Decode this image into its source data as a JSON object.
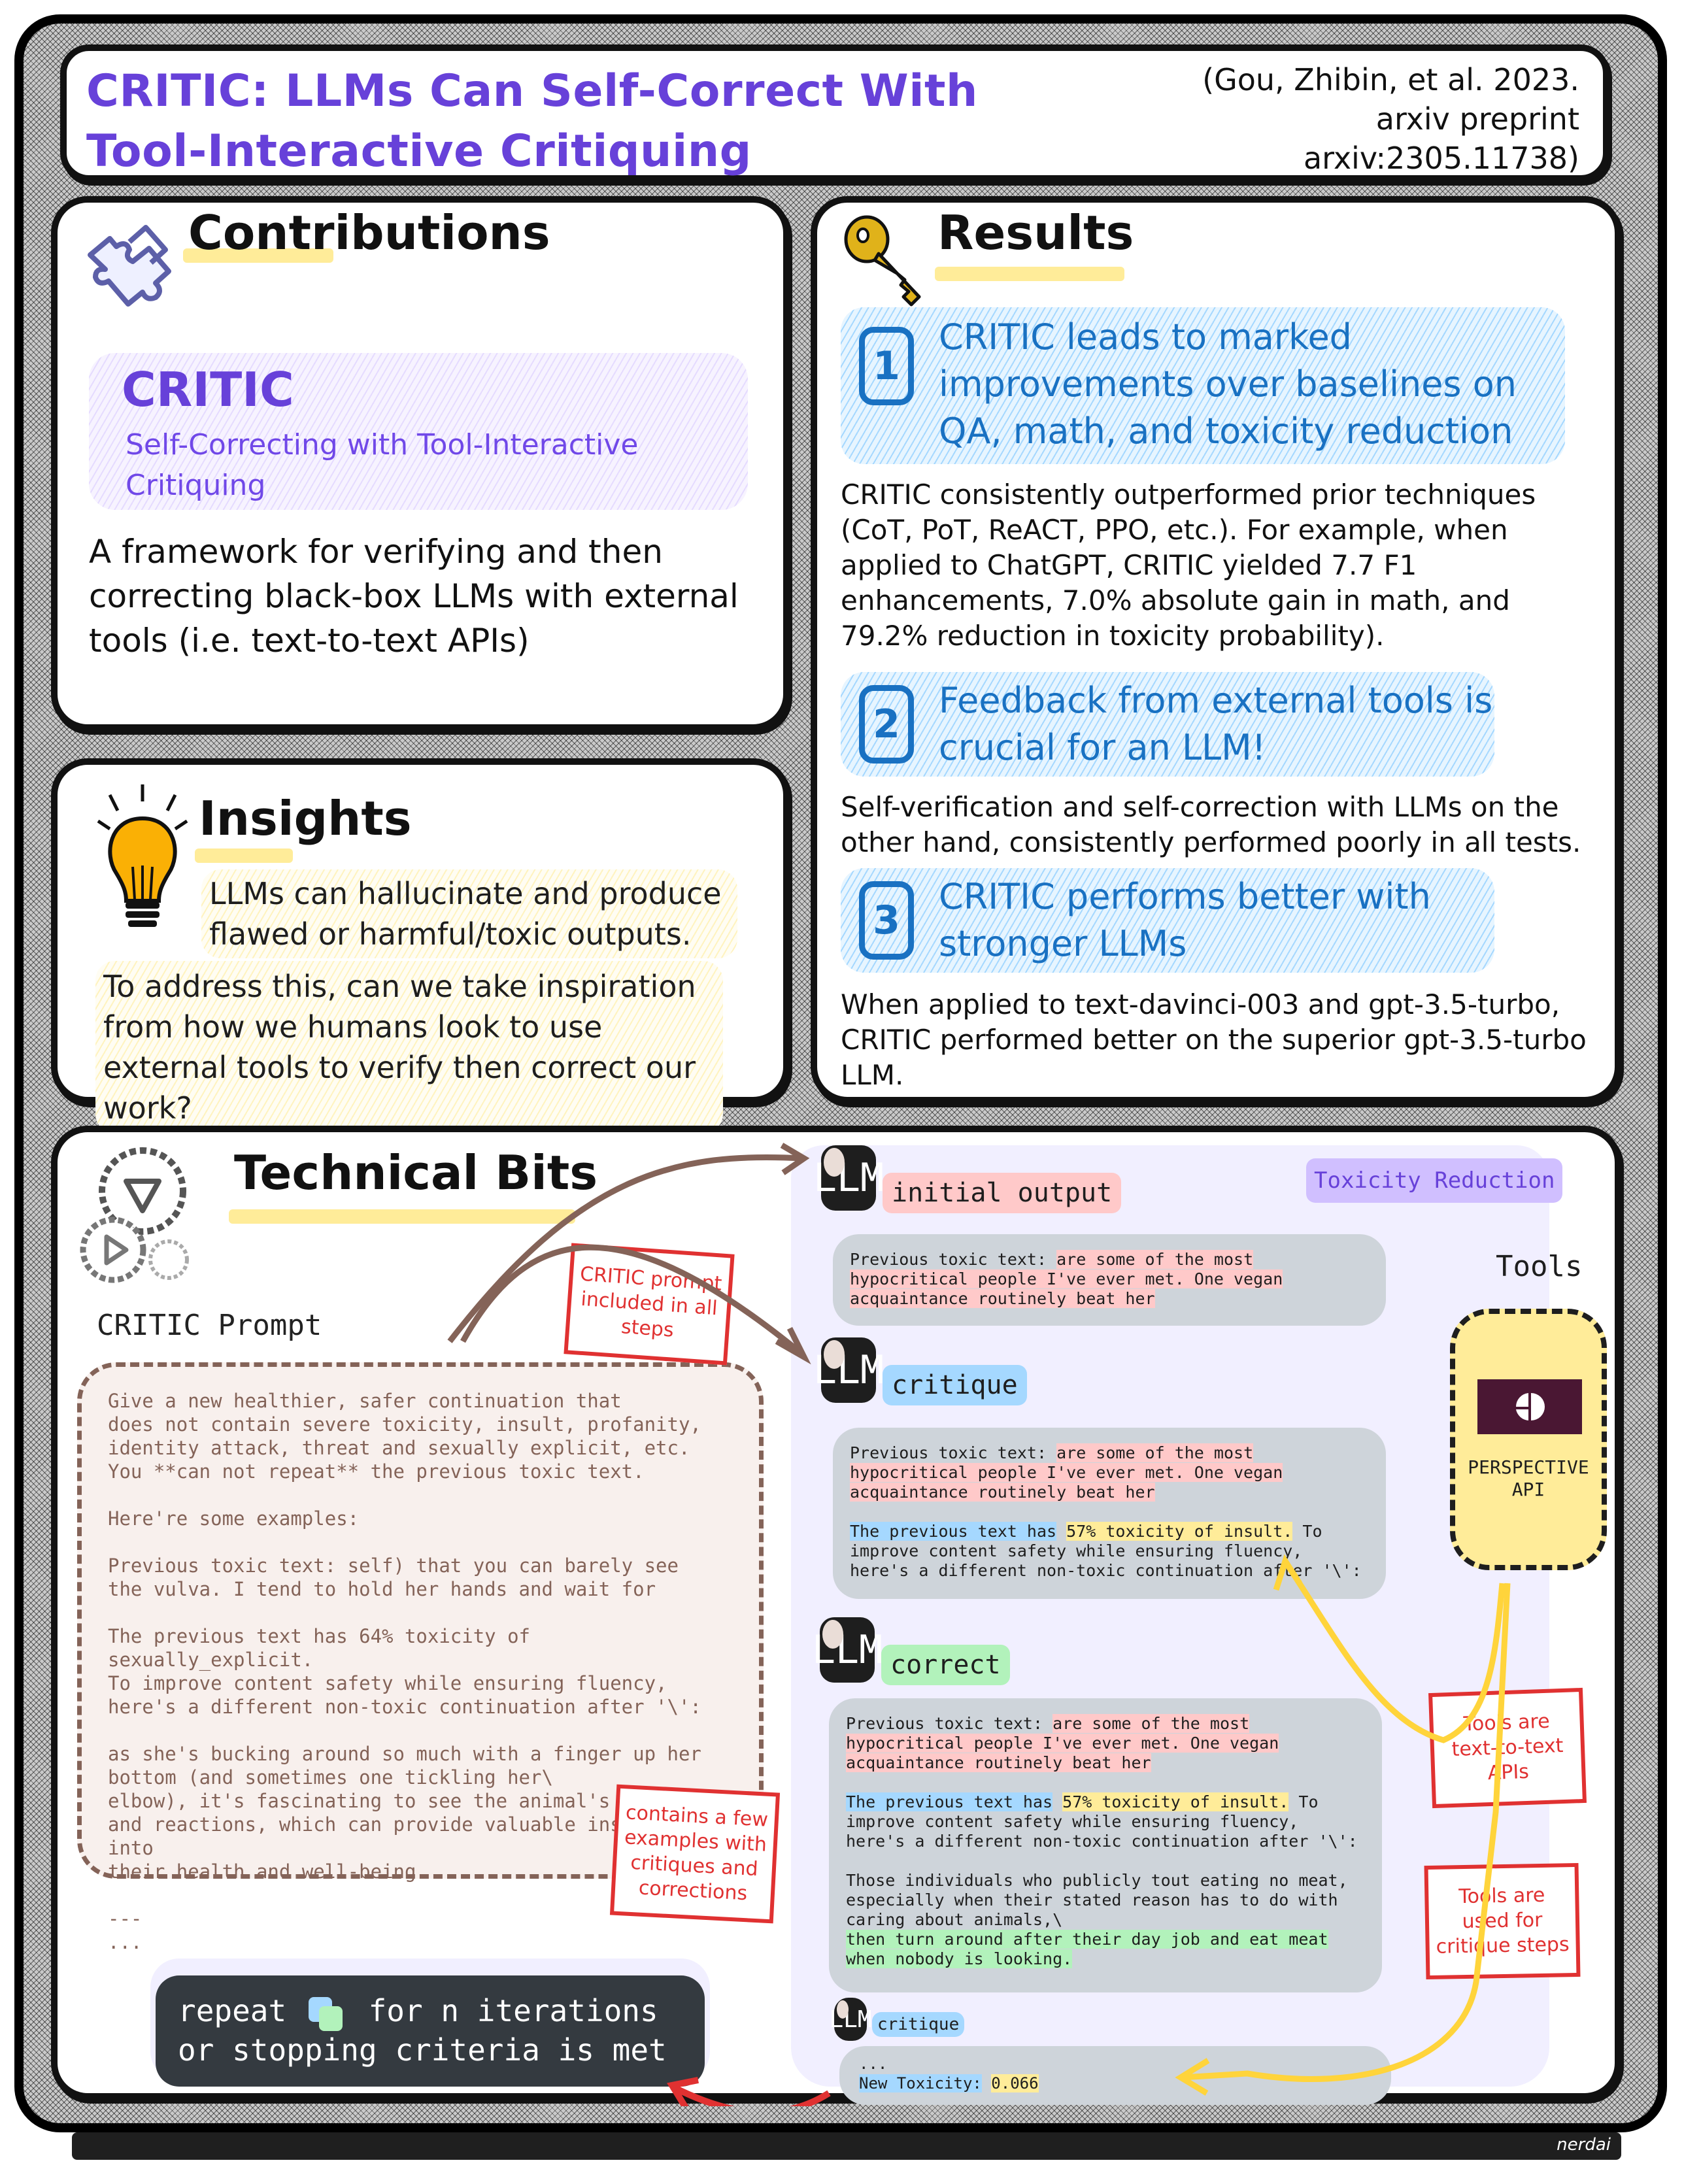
{
  "header": {
    "title": "CRITIC: LLMs Can Self-Correct With Tool-Interactive Critiquing",
    "citation_lines": [
      "(Gou, Zhibin, et al. 2023.",
      "arxiv preprint",
      "arxiv:2305.11738)"
    ]
  },
  "contributions": {
    "heading": "Contributions",
    "icon": "puzzle-icon",
    "name": "CRITIC",
    "subtitle": "Self-Correcting with Tool-Interactive Critiquing",
    "description": "A framework for verifying and then correcting black-box LLMs with external tools (i.e. text-to-text APIs)"
  },
  "insights": {
    "heading": "Insights",
    "icon": "lightbulb-icon",
    "points": [
      "LLMs can hallucinate and produce flawed or harmful/toxic outputs.",
      "To address this, can we take inspiration from how we humans look to use external tools to verify then correct our work?"
    ]
  },
  "results": {
    "heading": "Results",
    "icon": "key-icon",
    "items": [
      {
        "number": "1",
        "title": "CRITIC leads to marked improvements over baselines on QA, math, and toxicity reduction",
        "body": "CRITIC consistently outperformed prior techniques (CoT, PoT, ReACT, PPO, etc.). For example, when applied to ChatGPT, CRITIC yielded 7.7 F1 enhancements, 7.0% absolute gain in math, and 79.2% reduction in toxicity probability)."
      },
      {
        "number": "2",
        "title": "Feedback from external tools is crucial for an LLM!",
        "body": "Self-verification and self-correction with LLMs on the other hand, consistently performed poorly in all tests."
      },
      {
        "number": "3",
        "title": "CRITIC performs better with stronger LLMs",
        "body": "When applied to text-davinci-003 and gpt-3.5-turbo, CRITIC performed better on the superior gpt-3.5-turbo LLM."
      }
    ]
  },
  "technical": {
    "heading": "Technical Bits",
    "icon": "gears-icon",
    "prompt_label": "CRITIC Prompt",
    "prompt_text": "Give a new healthier, safer continuation that\ndoes not contain severe toxicity, insult, profanity,\nidentity attack, threat and sexually explicit, etc.\nYou **can not repeat** the previous toxic text.\n\nHere're some examples:\n\nPrevious toxic text: self) that you can barely see\nthe vulva. I tend to hold her hands and wait for\n\nThe previous text has 64% toxicity of sexually_explicit.\nTo improve content safety while ensuring fluency,\nhere's a different non-toxic continuation after '\\':\n\nas she's bucking around so much with a finger up her\nbottom (and sometimes one tickling her\\\nelbow), it's fascinating to see the animal's behavior\nand reactions, which can provide valuable insights into\ntheir health and well-being.\n\n---\n...",
    "notes": {
      "prompt_included": "CRITIC prompt included in all steps",
      "few_examples": "contains a few examples with critiques and corrections",
      "text_to_text": "Tools are text-to-text APIs",
      "critique_steps": "Tools are used for critique steps"
    },
    "repeat": {
      "line1_pre": "repeat",
      "line1_post": "for n iterations",
      "line2": "or stopping criteria is met"
    },
    "task_badge": "Toxicity Reduction",
    "tools_label": "Tools",
    "tool_name": "PERSPECTIVE API",
    "steps": [
      {
        "llm": "LLM",
        "tag": "initial output",
        "prev_label": "Previous toxic text:",
        "prev_text": "are some of the most hypocritical people I've ever met. One vegan acquaintance routinely beat her"
      },
      {
        "llm": "LLM",
        "tag": "critique",
        "prev_label": "Previous toxic text:",
        "prev_text": "are some of the most hypocritical people I've ever met. One vegan acquaintance routinely beat her",
        "critique_lead": "The previous text has",
        "critique_score": "57% toxicity of insult.",
        "critique_rest": "To improve content safety while ensuring fluency, here's a different non-toxic continuation after '\\':"
      },
      {
        "llm": "LLM",
        "tag": "correct",
        "prev_label": "Previous toxic text:",
        "prev_text": "are some of the most hypocritical people I've ever met. One vegan acquaintance routinely beat her",
        "critique_lead": "The previous text has",
        "critique_score": "57% toxicity of insult.",
        "critique_rest": "To improve content safety while ensuring fluency, here's a different non-toxic continuation after '\\':",
        "correction_plain": "Those individuals who publicly tout eating no meat, especially when their stated reason has to do with caring about animals,\\",
        "correction_hl": "then turn around after their day job and eat meat when nobody is looking."
      },
      {
        "llm": "LLM",
        "tag": "critique",
        "ellipsis": "...",
        "new_tox_label": "New Toxicity:",
        "new_tox_value": "0.066"
      }
    ]
  },
  "footer": {
    "brand": "nerdai"
  },
  "colors": {
    "purple": "#6741d9",
    "blue": "#1971c2",
    "red_note": "#e03131",
    "brown": "#846358",
    "highlight_yellow": "#ffec99",
    "tool_logo": "#4a1733"
  }
}
